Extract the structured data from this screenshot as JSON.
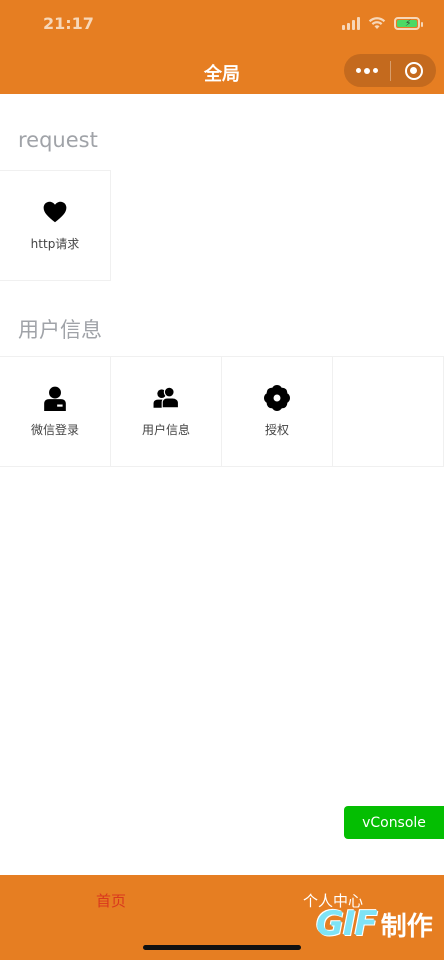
{
  "status_bar": {
    "time": "21:17"
  },
  "nav": {
    "title": "全局"
  },
  "sections": [
    {
      "title": "request",
      "items": [
        {
          "label": "http请求",
          "icon": "heart-icon"
        }
      ]
    },
    {
      "title": "用户信息",
      "items": [
        {
          "label": "微信登录",
          "icon": "user-badge-icon"
        },
        {
          "label": "用户信息",
          "icon": "users-icon"
        },
        {
          "label": "授权",
          "icon": "flower-icon"
        }
      ]
    }
  ],
  "vconsole": {
    "label": "vConsole"
  },
  "tabbar": {
    "items": [
      {
        "label": "首页",
        "active": true
      },
      {
        "label": "个人中心",
        "active": false
      }
    ]
  },
  "watermark": {
    "gif": "GIF",
    "text": "制作"
  },
  "colors": {
    "header": "#E67E22",
    "tab_active": "#D9381E",
    "vconsole": "#04BE02"
  }
}
